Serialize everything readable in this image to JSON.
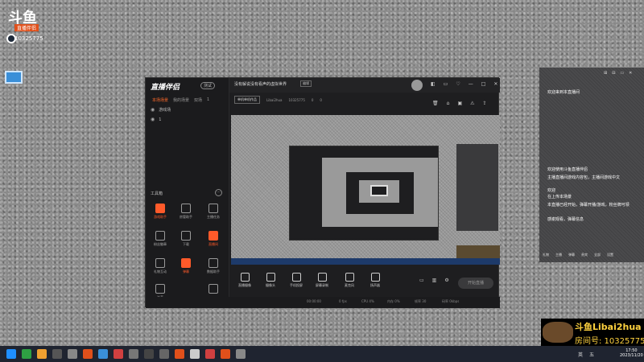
{
  "desktop": {
    "logo_text": "斗鱼",
    "logo_sub": "直播伴侣",
    "room_no": "10325775"
  },
  "app": {
    "brand": "直播伴侣",
    "brand_tag": "测试",
    "side_tabs": [
      "本场场景",
      "我的场景",
      "双场",
      "1"
    ],
    "scenes": [
      {
        "label": "游戏场"
      },
      {
        "label": "1"
      }
    ],
    "tools_title": "工具箱",
    "tools_more": "···",
    "tools": [
      {
        "label": "游戏助手",
        "accent": true
      },
      {
        "label": "房管助手",
        "accent": false
      },
      {
        "label": "主播任务",
        "accent": false
      },
      {
        "label": "粉丝徽章",
        "accent": false
      },
      {
        "label": "下载",
        "accent": false
      },
      {
        "label": "直播间",
        "accent": true
      },
      {
        "label": "礼物互动",
        "accent": false
      },
      {
        "label": "弹幕",
        "accent": true
      },
      {
        "label": "数据助手",
        "accent": false
      },
      {
        "label": "连麦",
        "accent": false
      },
      {
        "label": "",
        "accent": false
      },
      {
        "label": "",
        "accent": false
      }
    ],
    "side_footer": "斗鱼直播伴侣使用教程",
    "title_line": "没有解说没有看声的虚拟世界",
    "title_badge": "编辑",
    "category": "单机单机作品",
    "meta": [
      "Libai2hua",
      "10325775",
      "0",
      "0"
    ],
    "window_controls": [
      "◧",
      "▭",
      "♡",
      "—",
      "□",
      "✕"
    ],
    "sub_icons": [
      "🗑",
      "⌂",
      "▣",
      "⚠",
      "⇪"
    ],
    "bottom_items": [
      {
        "label": "直播摄像"
      },
      {
        "label": "摄像头"
      },
      {
        "label": "手机投屏"
      },
      {
        "label": "屏幕录制"
      },
      {
        "label": "麦克风"
      },
      {
        "label": "扬声器"
      }
    ],
    "start_live": "开始直播",
    "status_items": [
      "00:00:00",
      "0 fps",
      "CPU 4%",
      "内存 0%",
      "帧率 30",
      "码率 0kbps"
    ]
  },
  "chat": {
    "top_icons": [
      "⊞",
      "⊟",
      "▭",
      "✕"
    ],
    "messages": [
      "欢迎来到本直播间",
      "欢迎使用斗鱼直播伴侣",
      "主播直播间游戏内容包，主播间游戏中文",
      "欢迎",
      "在上传本场景",
      "本直播已经开始，弹幕开播/游戏，粉丝牌可领",
      "感谢观看，弹幕信息"
    ],
    "bottom_bar": [
      "礼物",
      "主播",
      "弹幕",
      "贵宾",
      "全部",
      "设置"
    ]
  },
  "watermark": {
    "line1": "斗鱼Libai2hua",
    "line2": "房间号: 10325775"
  },
  "taskbar": {
    "clock_time": "17:50",
    "clock_date": "2023/11/20",
    "tray": [
      "英",
      "五"
    ],
    "icon_colors": [
      "#1f8fff",
      "#2ea043",
      "#f0a030",
      "#555",
      "#888",
      "#e0501b",
      "#3a8fd8",
      "#d04040",
      "#777",
      "#444",
      "#666",
      "#e0501b",
      "#ccc",
      "#d04040",
      "#e0501b",
      "#888"
    ]
  },
  "colors": {
    "accent": "#ff5a2a",
    "watermark": "#ffd23f"
  }
}
